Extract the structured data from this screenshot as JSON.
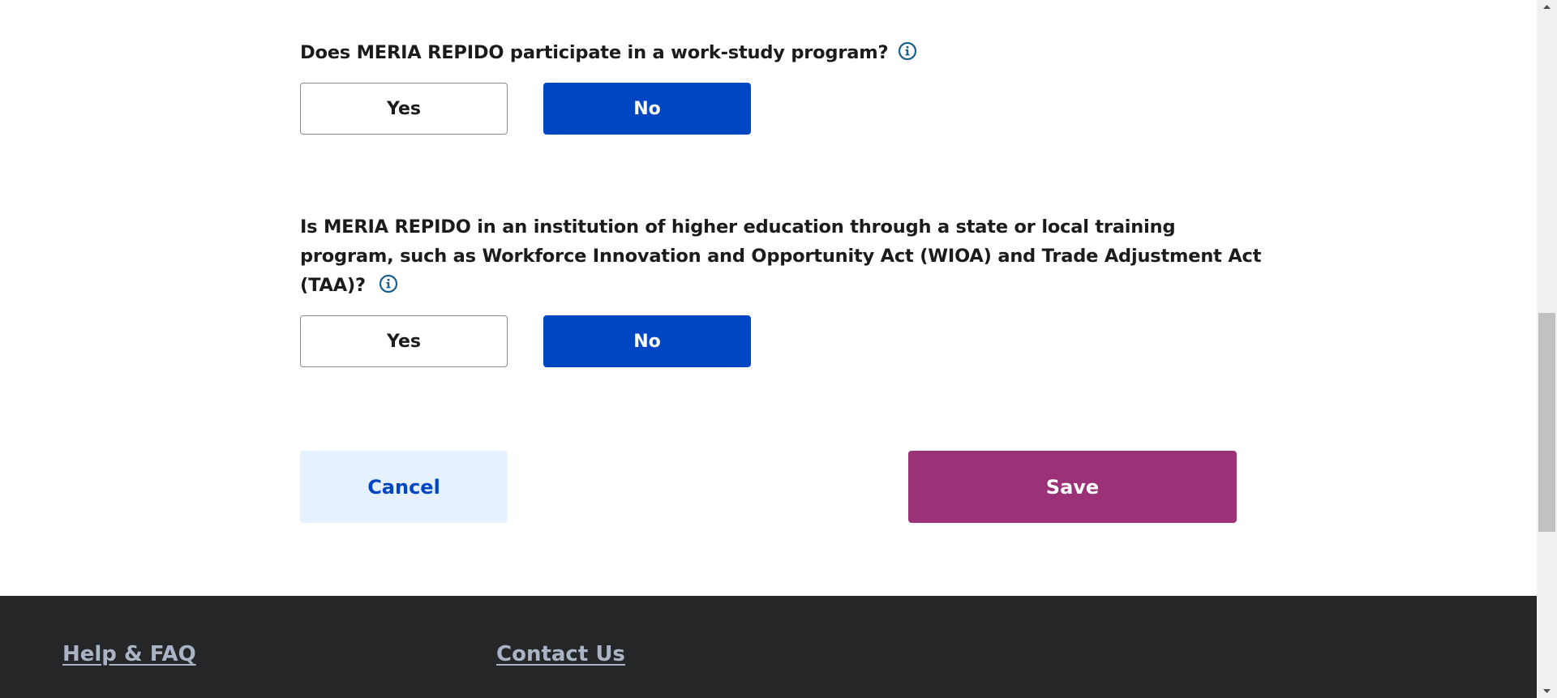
{
  "questions": [
    {
      "text": "Does MERIA REPIDO participate in a work-study program?",
      "info_icon": "info-circle-icon",
      "options": {
        "yes": "Yes",
        "no": "No"
      },
      "selected": "No"
    },
    {
      "text": "Is MERIA REPIDO in an institution of higher education through a state or local training program, such as Workforce Innovation and Opportunity Act (WIOA) and Trade Adjustment Act (TAA)?",
      "info_icon": "info-circle-icon",
      "options": {
        "yes": "Yes",
        "no": "No"
      },
      "selected": "No"
    }
  ],
  "actions": {
    "cancel_label": "Cancel",
    "save_label": "Save"
  },
  "footer": {
    "help_link": "Help & FAQ",
    "contact_link": "Contact Us"
  },
  "colors": {
    "primary_blue": "#0046c3",
    "save_magenta": "#9b3177",
    "cancel_bg": "#e5f1fe",
    "footer_bg": "#252627",
    "footer_link": "#a9b4c6",
    "info_icon": "#1a5f8c"
  },
  "icons": {
    "info": "info-circle-icon",
    "scroll_up": "scroll-up-arrow-icon",
    "scroll_down": "scroll-down-arrow-icon"
  }
}
